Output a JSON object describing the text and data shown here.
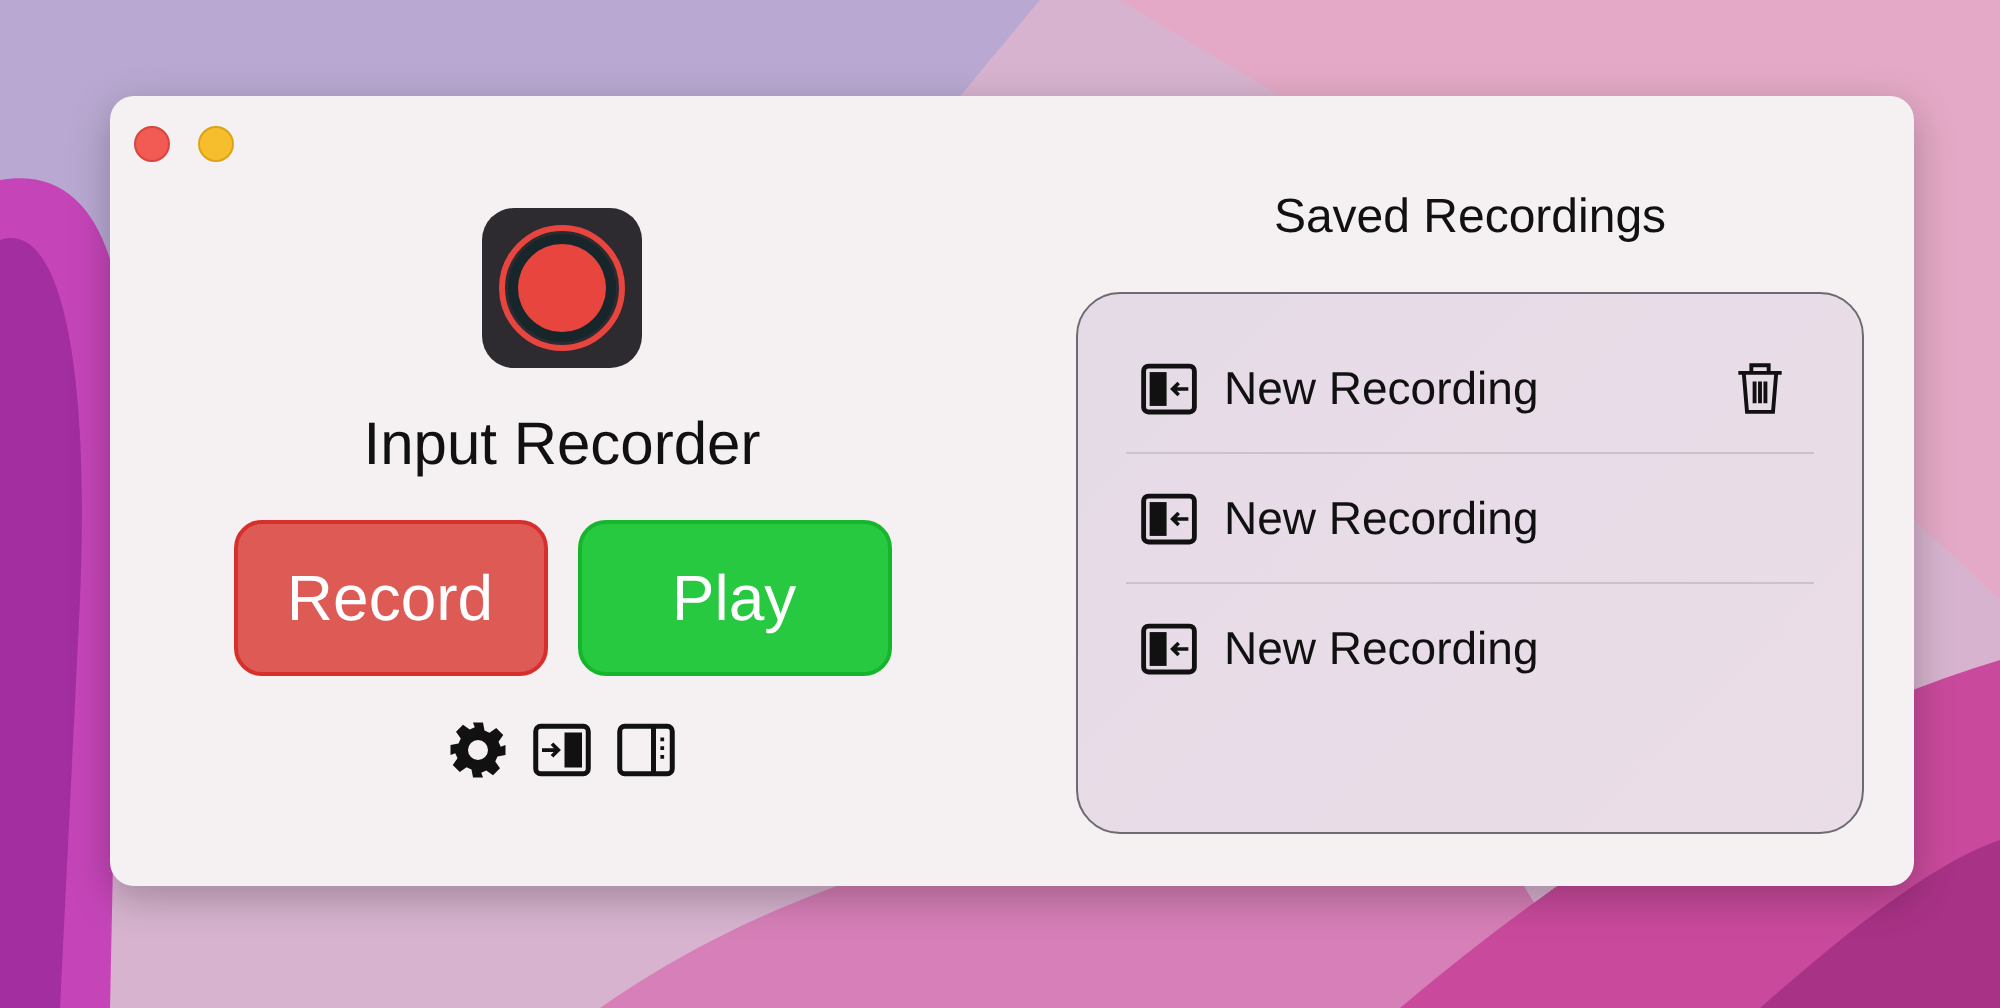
{
  "app": {
    "name": "Input Recorder",
    "buttons": [
      {
        "kind": "record",
        "label": "Record"
      },
      {
        "kind": "play",
        "label": "Play"
      }
    ]
  },
  "saved": {
    "title": "Saved Recordings",
    "items": [
      {
        "name": "New Recording",
        "hovered": true
      },
      {
        "name": "New Recording",
        "hovered": false
      },
      {
        "name": "New Recording",
        "hovered": false
      }
    ]
  }
}
